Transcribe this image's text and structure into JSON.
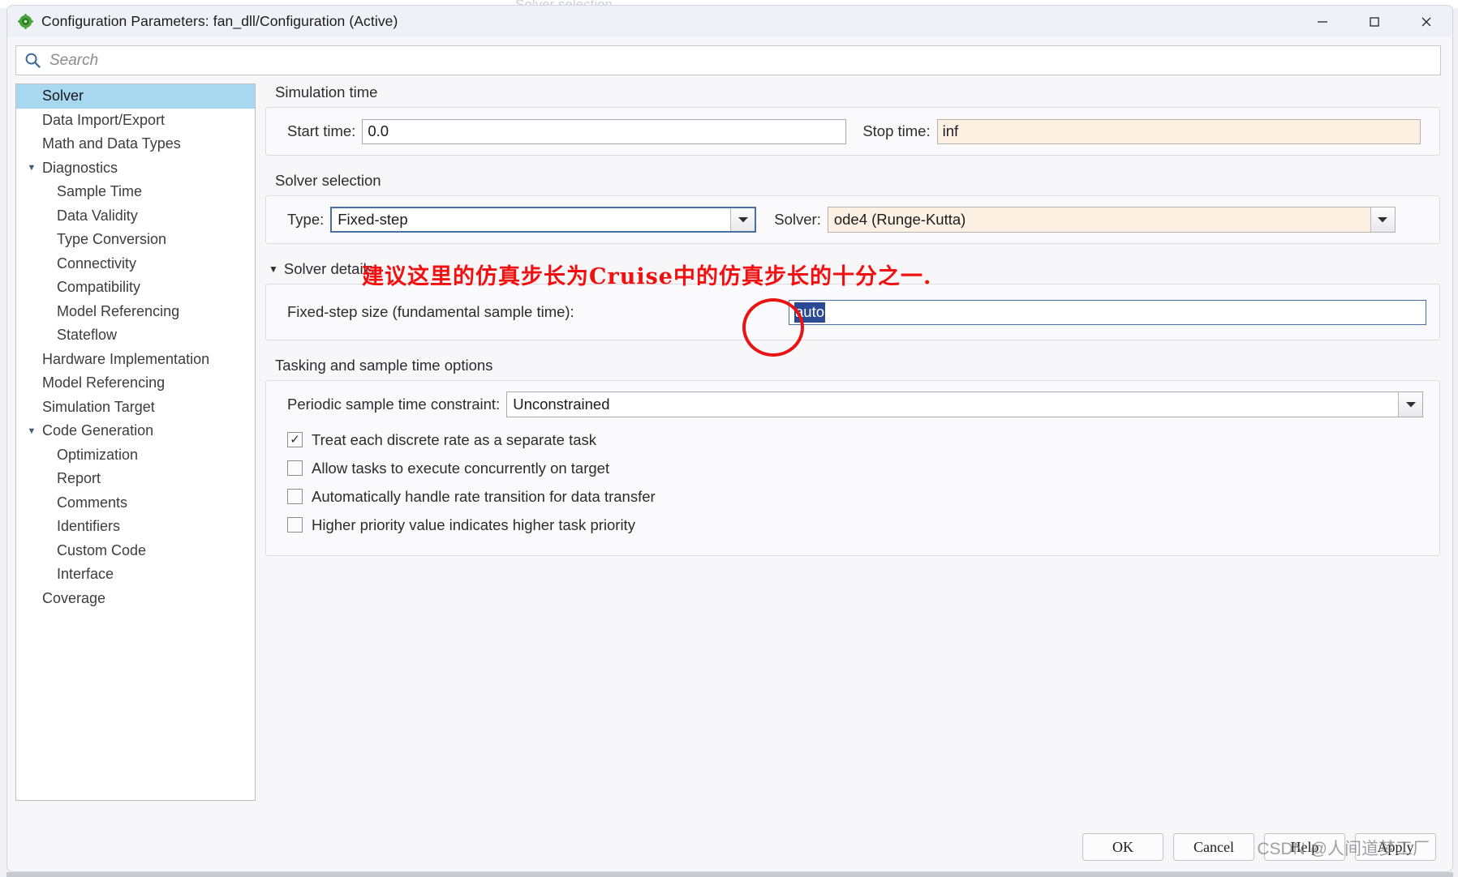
{
  "window": {
    "title": "Configuration Parameters: fan_dll/Configuration (Active)",
    "icon": "simulink-gear-icon",
    "minimize_label": "—",
    "maximize_label": "□",
    "close_label": "✕",
    "ghost_text_left": "Solver selection",
    "ghost_text_right": "Solver selection"
  },
  "search": {
    "placeholder": "Search",
    "value": "",
    "icon": "search-icon"
  },
  "sidebar": {
    "items": [
      {
        "label": "Solver",
        "depth": 0,
        "caret": "",
        "selected": true
      },
      {
        "label": "Data Import/Export",
        "depth": 0,
        "caret": "",
        "selected": false
      },
      {
        "label": "Math and Data Types",
        "depth": 0,
        "caret": "",
        "selected": false
      },
      {
        "label": "Diagnostics",
        "depth": 0,
        "caret": "▼",
        "selected": false
      },
      {
        "label": "Sample Time",
        "depth": 1,
        "caret": "",
        "selected": false
      },
      {
        "label": "Data Validity",
        "depth": 1,
        "caret": "",
        "selected": false
      },
      {
        "label": "Type Conversion",
        "depth": 1,
        "caret": "",
        "selected": false
      },
      {
        "label": "Connectivity",
        "depth": 1,
        "caret": "",
        "selected": false
      },
      {
        "label": "Compatibility",
        "depth": 1,
        "caret": "",
        "selected": false
      },
      {
        "label": "Model Referencing",
        "depth": 1,
        "caret": "",
        "selected": false
      },
      {
        "label": "Stateflow",
        "depth": 1,
        "caret": "",
        "selected": false
      },
      {
        "label": "Hardware Implementation",
        "depth": 0,
        "caret": "",
        "selected": false
      },
      {
        "label": "Model Referencing",
        "depth": 0,
        "caret": "",
        "selected": false
      },
      {
        "label": "Simulation Target",
        "depth": 0,
        "caret": "",
        "selected": false
      },
      {
        "label": "Code Generation",
        "depth": 0,
        "caret": "▼",
        "selected": false
      },
      {
        "label": "Optimization",
        "depth": 1,
        "caret": "",
        "selected": false
      },
      {
        "label": "Report",
        "depth": 1,
        "caret": "",
        "selected": false
      },
      {
        "label": "Comments",
        "depth": 1,
        "caret": "",
        "selected": false
      },
      {
        "label": "Identifiers",
        "depth": 1,
        "caret": "",
        "selected": false
      },
      {
        "label": "Custom Code",
        "depth": 1,
        "caret": "",
        "selected": false
      },
      {
        "label": "Interface",
        "depth": 1,
        "caret": "",
        "selected": false
      },
      {
        "label": "Coverage",
        "depth": 0,
        "caret": "",
        "selected": false
      }
    ]
  },
  "main": {
    "simulation_time": {
      "section_title": "Simulation time",
      "start_time_label": "Start time:",
      "start_time_value": "0.0",
      "stop_time_label": "Stop time:",
      "stop_time_value": "inf"
    },
    "solver_selection": {
      "section_title": "Solver selection",
      "type_label": "Type:",
      "type_value": "Fixed-step",
      "solver_label": "Solver:",
      "solver_value": "ode4 (Runge-Kutta)",
      "dropdown_arrow": "▼"
    },
    "solver_details": {
      "disclosure_label": "Solver details",
      "disclosure_caret": "▼",
      "fixed_step_label": "Fixed-step size (fundamental sample time):",
      "fixed_step_value": "auto"
    },
    "tasking": {
      "section_title": "Tasking and sample time options",
      "constraint_label": "Periodic sample time constraint:",
      "constraint_value": "Unconstrained",
      "dropdown_arrow": "▼",
      "checkboxes": [
        {
          "label": "Treat each discrete rate as a separate task",
          "checked": true,
          "mark": "✓"
        },
        {
          "label": "Allow tasks to execute concurrently on target",
          "checked": false,
          "mark": ""
        },
        {
          "label": "Automatically handle rate transition for data transfer",
          "checked": false,
          "mark": ""
        },
        {
          "label": "Higher priority value indicates higher task priority",
          "checked": false,
          "mark": ""
        }
      ]
    }
  },
  "annotation": {
    "text": "建议这里的仿真步长为Cruise中的仿真步长的十分之一.",
    "color": "#f20f0f",
    "circle_target": "fixed-step-size-input"
  },
  "footer": {
    "buttons": [
      {
        "label": "OK",
        "name": "ok-button"
      },
      {
        "label": "Cancel",
        "name": "cancel-button"
      },
      {
        "label": "Help",
        "name": "help-button"
      },
      {
        "label": "Apply",
        "name": "apply-button"
      }
    ]
  },
  "watermark": {
    "text": "CSDN @人间道梦工厂"
  }
}
